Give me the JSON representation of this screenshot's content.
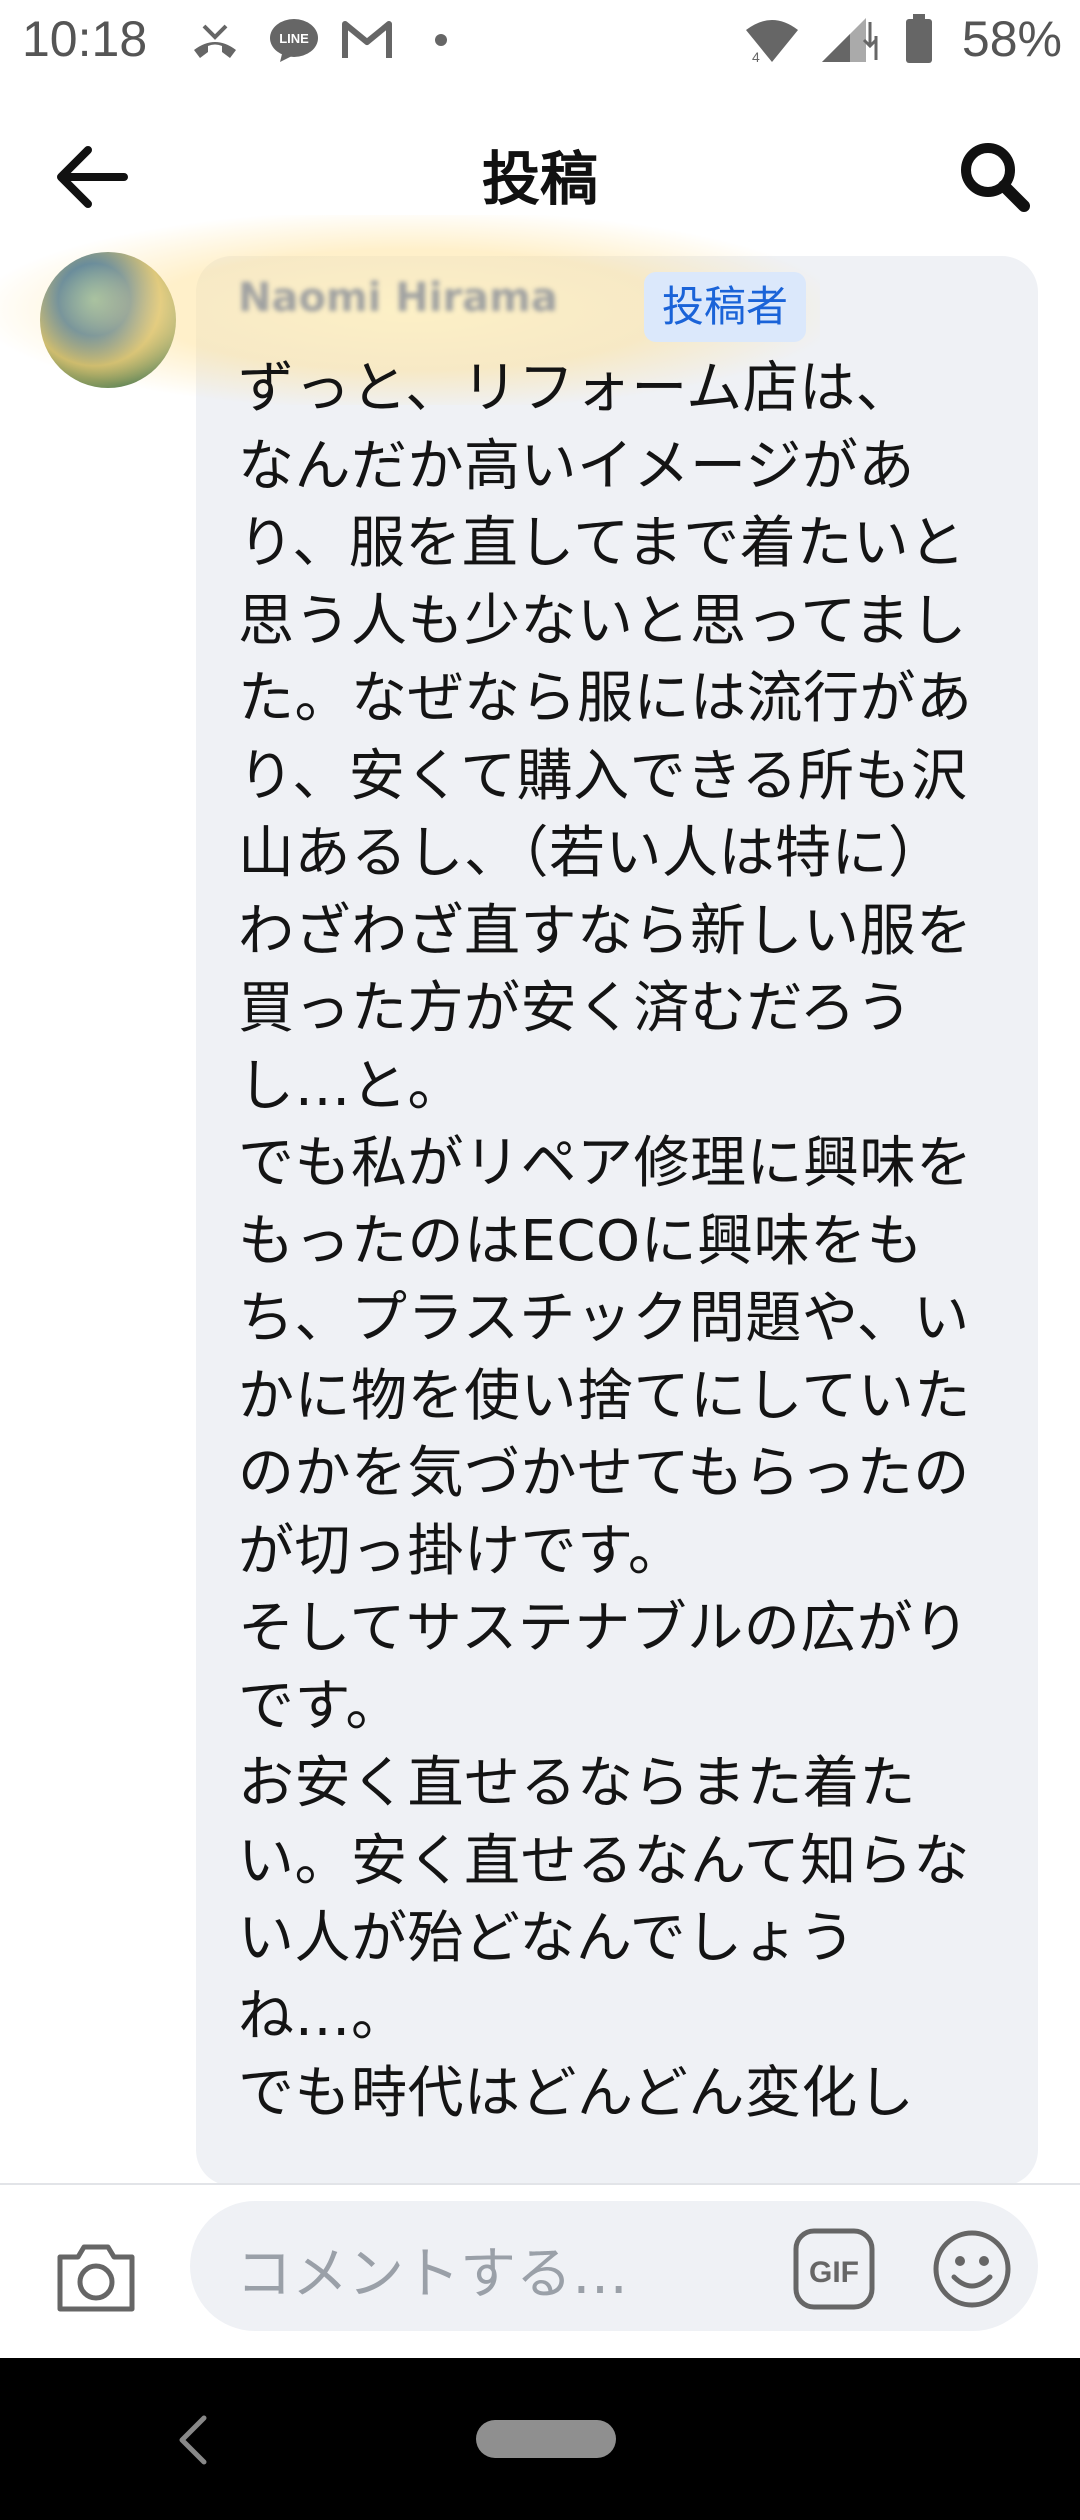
{
  "status_bar": {
    "time": "10:18",
    "battery": "58%",
    "icons": [
      "missed-call-icon",
      "line-app-icon",
      "gmail-icon",
      "dot-icon",
      "wifi-icon",
      "signal-icon",
      "battery-icon"
    ]
  },
  "header": {
    "title": "投稿"
  },
  "post": {
    "author_name": "Naomi Hirama",
    "author_badge": "投稿者",
    "text": "ずっと、リフォーム店は、\nなんだか高いイメージがあり、服を直してまで着たいと思う人も少ないと思ってました。なぜなら服には流行があり、安くて購入できる所も沢山あるし、（若い人は特に）わざわざ直すなら新しい服を買った方が安く済むだろうし…と。\nでも私がリペア修理に興味をもったのはECOに興味をもち、プラスチック問題や、いかに物を使い捨てにしていたのかを気づかせてもらったのが切っ掛けです。\nそしてサステナブルの広がりです。\nお安く直せるならまた着たい。安く直せるなんて知らない人が殆どなんでしょうね…。\nでも時代はどんどん変化し"
  },
  "composer": {
    "placeholder": "コメントする…",
    "gif_label": "GIF"
  },
  "colors": {
    "badge_bg": "#dbe8fb",
    "badge_text": "#1a63d8",
    "bubble_bg": "#eff1f5"
  }
}
